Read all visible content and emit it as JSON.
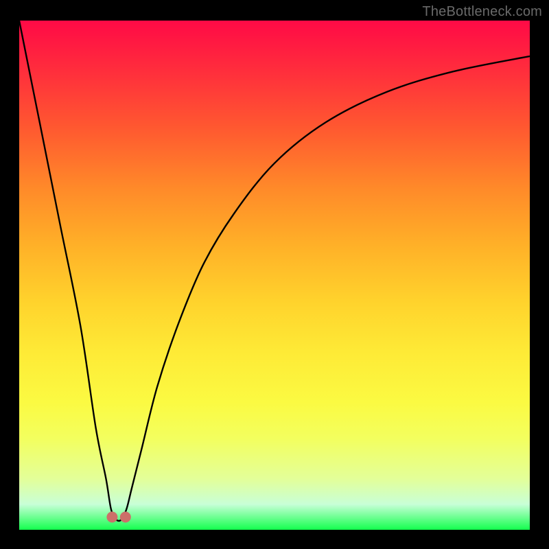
{
  "watermark": "TheBottleneck.com",
  "chart_data": {
    "type": "line",
    "title": "",
    "xlabel": "",
    "ylabel": "",
    "xlim": [
      0,
      100
    ],
    "ylim": [
      0,
      100
    ],
    "grid": false,
    "legend": null,
    "series": [
      {
        "name": "bottleneck-curve",
        "x": [
          0,
          4,
          8,
          12,
          15,
          17,
          18,
          19,
          20,
          21,
          22,
          24,
          27,
          31,
          36,
          42,
          50,
          60,
          72,
          85,
          100
        ],
        "y": [
          100,
          80,
          60,
          40,
          20,
          10,
          4,
          2,
          2,
          4,
          8,
          16,
          28,
          40,
          52,
          62,
          72,
          80,
          86,
          90,
          93
        ]
      }
    ],
    "markers": [
      {
        "x": 18.2,
        "y": 2.5
      },
      {
        "x": 20.8,
        "y": 2.5
      }
    ],
    "gradient_stops": [
      {
        "pos": 0.0,
        "color": "#ff0a46"
      },
      {
        "pos": 0.1,
        "color": "#ff2e3c"
      },
      {
        "pos": 0.21,
        "color": "#ff5830"
      },
      {
        "pos": 0.33,
        "color": "#ff8a29"
      },
      {
        "pos": 0.44,
        "color": "#ffb028"
      },
      {
        "pos": 0.55,
        "color": "#ffd22c"
      },
      {
        "pos": 0.65,
        "color": "#feea36"
      },
      {
        "pos": 0.75,
        "color": "#fbfa42"
      },
      {
        "pos": 0.82,
        "color": "#f3ff5e"
      },
      {
        "pos": 0.9,
        "color": "#e3ff99"
      },
      {
        "pos": 0.95,
        "color": "#c8ffd7"
      },
      {
        "pos": 1.0,
        "color": "#14ff4e"
      }
    ],
    "marker_color": "#cc6f69",
    "curve_color": "#000000"
  }
}
